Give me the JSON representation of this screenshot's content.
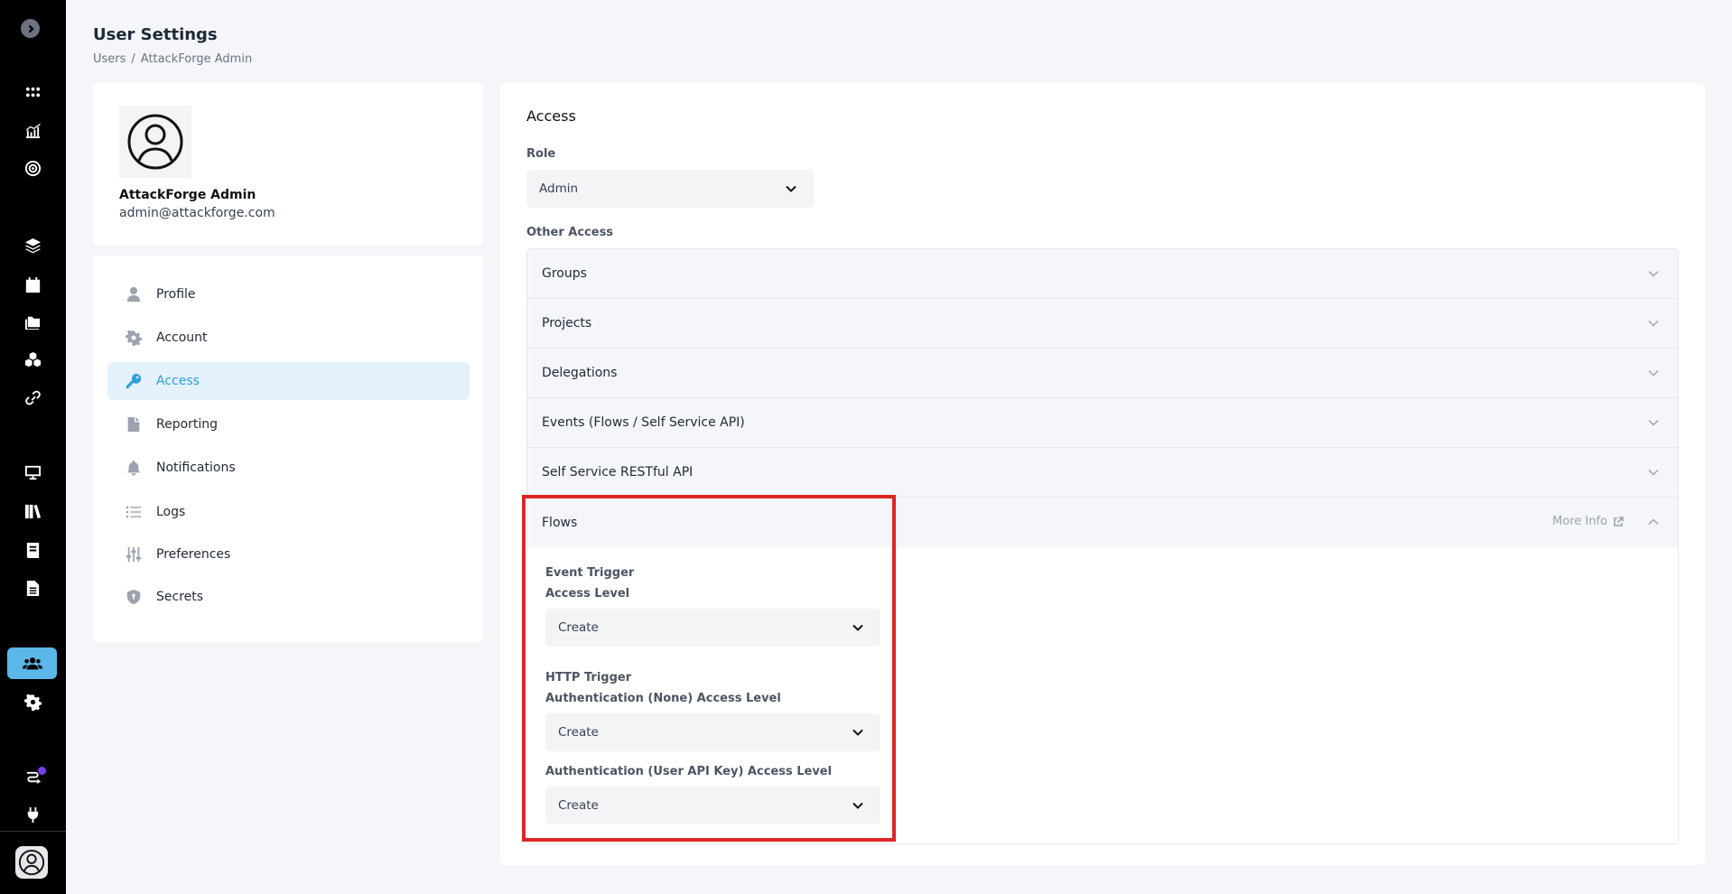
{
  "header": {
    "title": "User Settings",
    "breadcrumb": [
      "Users",
      "/",
      "AttackForge Admin"
    ]
  },
  "rail": {
    "icons": [
      "chevron-right-icon",
      "grid-icon",
      "chart-icon",
      "target-icon",
      "layers-icon",
      "calendar-icon",
      "folders-icon",
      "cubes-icon",
      "link-icon",
      "monitor-icon",
      "library-icon",
      "book-icon",
      "document-icon",
      "users-icon",
      "gear-icon",
      "flow-icon",
      "plug-icon",
      "avatar-icon"
    ],
    "active": "users-icon",
    "badge_color": "#7c3aed"
  },
  "profile": {
    "name": "AttackForge Admin",
    "email": "admin@attackforge.com"
  },
  "nav": {
    "items": [
      {
        "label": "Profile",
        "icon": "user-icon"
      },
      {
        "label": "Account",
        "icon": "gear-icon"
      },
      {
        "label": "Access",
        "icon": "key-icon",
        "active": true
      },
      {
        "label": "Reporting",
        "icon": "file-icon"
      },
      {
        "label": "Notifications",
        "icon": "bell-icon"
      },
      {
        "label": "Logs",
        "icon": "list-icon"
      },
      {
        "label": "Preferences",
        "icon": "sliders-icon"
      },
      {
        "label": "Secrets",
        "icon": "shield-icon"
      }
    ]
  },
  "access": {
    "title": "Access",
    "role_label": "Role",
    "role_value": "Admin",
    "other_label": "Other Access",
    "sections": [
      "Groups",
      "Projects",
      "Delegations",
      "Events (Flows / Self Service API)",
      "Self Service RESTful API",
      "Flows"
    ],
    "more_info": "More Info",
    "flows": {
      "event_trigger_label": "Event Trigger",
      "event_access_label": "Access Level",
      "event_access_value": "Create",
      "http_trigger_label": "HTTP Trigger",
      "auth_none_label": "Authentication (None) Access Level",
      "auth_none_value": "Create",
      "auth_key_label": "Authentication (User API Key) Access Level",
      "auth_key_value": "Create"
    }
  },
  "colors": {
    "accent": "#2d9fd9",
    "highlight": "#dc2626",
    "rail": "#000000"
  }
}
